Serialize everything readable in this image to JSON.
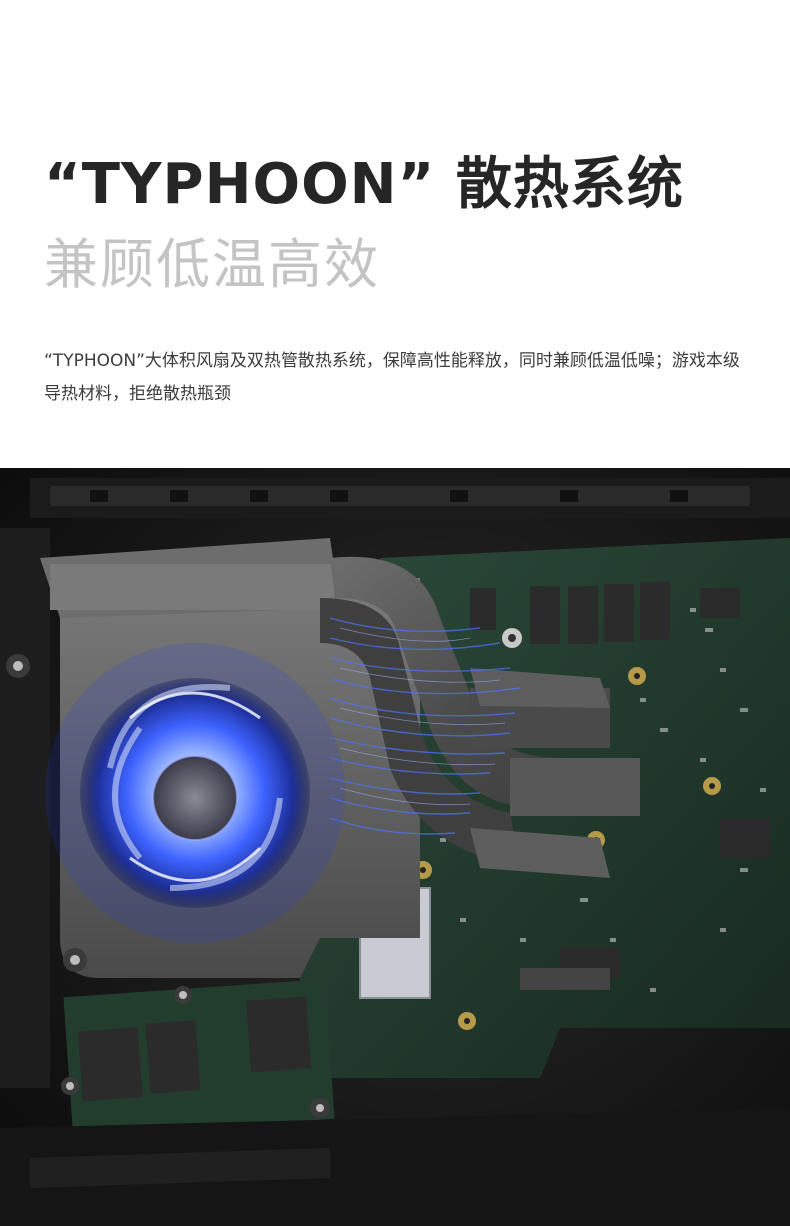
{
  "headline": "“TYPHOON” 散热系统",
  "subheadline": "兼顾低温高效",
  "description": "“TYPHOON”大体积风扇及双热管散热系统，保障高性能释放，同时兼顾低温低噪；游戏本级导热材料，拒绝散热瓶颈",
  "image": {
    "subject": "laptop-internal-cooling-system",
    "accent_color": "#3a6cff",
    "board_color": "#1f3a2c",
    "heatpipe_color": "#5a5a5a"
  }
}
